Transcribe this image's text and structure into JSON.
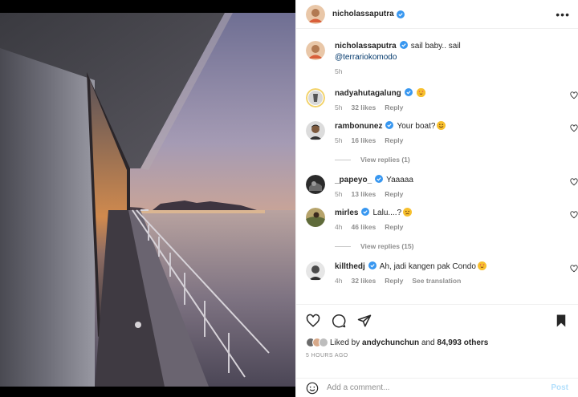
{
  "post": {
    "author": "nicholassaputra",
    "caption": "sail baby.. sail",
    "mention": "@terrariokomodo",
    "caption_time": "5h"
  },
  "comments": [
    {
      "user": "nadyahutagalung",
      "text": "",
      "emoji": "heart-eyes",
      "time": "5h",
      "likes": "32 likes",
      "reply": "Reply",
      "verified": true
    },
    {
      "user": "rambonunez",
      "text": "Your boat?",
      "emoji": "smile",
      "time": "5h",
      "likes": "16 likes",
      "reply": "Reply",
      "verified": true,
      "view_replies": "View replies (1)"
    },
    {
      "user": "_papeyo_",
      "text": "Yaaaaa",
      "emoji": "",
      "time": "5h",
      "likes": "13 likes",
      "reply": "Reply",
      "verified": true
    },
    {
      "user": "mirles",
      "text": "Lalu....?",
      "emoji": "worried",
      "time": "4h",
      "likes": "46 likes",
      "reply": "Reply",
      "verified": true,
      "view_replies": "View replies (15)"
    },
    {
      "user": "killthedj",
      "text": "Ah, jadi kangen pak Condo",
      "emoji": "heart-eyes",
      "time": "4h",
      "likes": "32 likes",
      "reply": "Reply",
      "extra": "See translation",
      "verified": true
    }
  ],
  "likes_line": {
    "prefix": "Liked by",
    "user": "andychunchun",
    "middle": "and",
    "count": "84,993 others"
  },
  "timestamp": "5 HOURS AGO",
  "add_comment": {
    "placeholder": "Add a comment...",
    "post_label": "Post"
  },
  "icons": {
    "more": "more-options-icon",
    "like": "heart-outline-icon",
    "comment": "comment-bubble-icon",
    "share": "paper-plane-icon",
    "save": "bookmark-filled-icon",
    "emoji": "emoji-smiley-icon"
  },
  "colors": {
    "verified": "#3897f0",
    "link": "#00376b",
    "secondary_text": "#8e8e8e",
    "post_button_disabled": "#b2dffc"
  }
}
